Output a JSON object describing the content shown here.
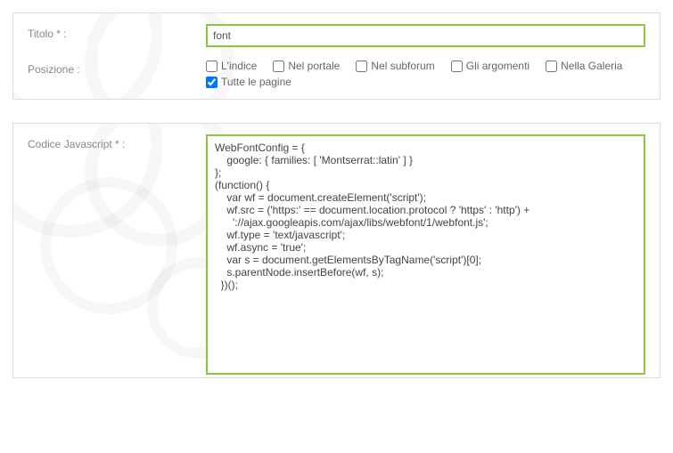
{
  "form": {
    "titolo_label": "Titolo * :",
    "titolo_value": "font",
    "posizione_label": "Posizione :",
    "posizione_options": [
      {
        "label": "L'indice",
        "checked": false
      },
      {
        "label": "Nel portale",
        "checked": false
      },
      {
        "label": "Nel subforum",
        "checked": false
      },
      {
        "label": "Gli argomenti",
        "checked": false
      },
      {
        "label": "Nella Galeria",
        "checked": false
      },
      {
        "label": "Tutte le pagine",
        "checked": true
      }
    ],
    "code_label": "Codice Javascript * :",
    "code_value": "WebFontConfig = {\n    google: { families: [ 'Montserrat::latin' ] }\n};\n(function() {\n    var wf = document.createElement('script');\n    wf.src = ('https:' == document.location.protocol ? 'https' : 'http') +\n      '://ajax.googleapis.com/ajax/libs/webfont/1/webfont.js';\n    wf.type = 'text/javascript';\n    wf.async = 'true';\n    var s = document.getElementsByTagName('script')[0];\n    s.parentNode.insertBefore(wf, s);\n  })();"
  }
}
